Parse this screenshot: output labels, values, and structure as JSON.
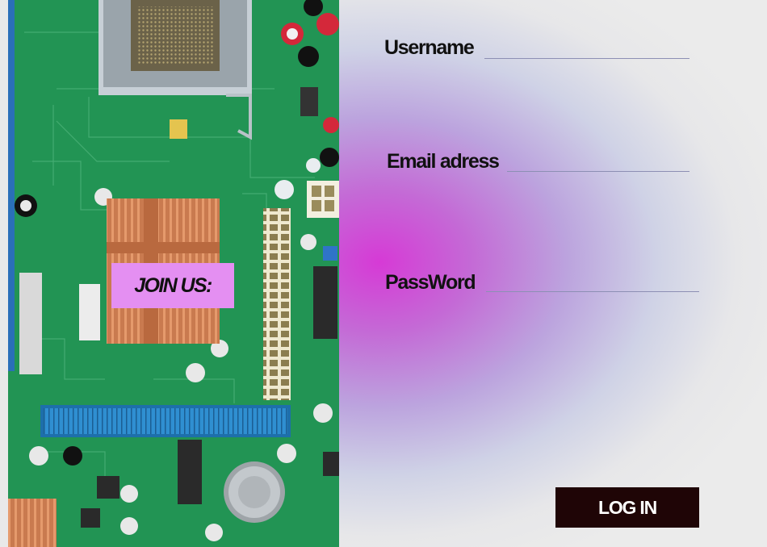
{
  "hero": {
    "image_subject": "motherboard-photo",
    "badge_label": "JOIN US:",
    "badge_color": "#e48ff2"
  },
  "form": {
    "username_label": "Username",
    "email_label": "Email adress",
    "password_label": "PassWord",
    "login_label": "LOG IN",
    "login_button_color": "#1f0506",
    "background_accent": "#d63ad6"
  }
}
